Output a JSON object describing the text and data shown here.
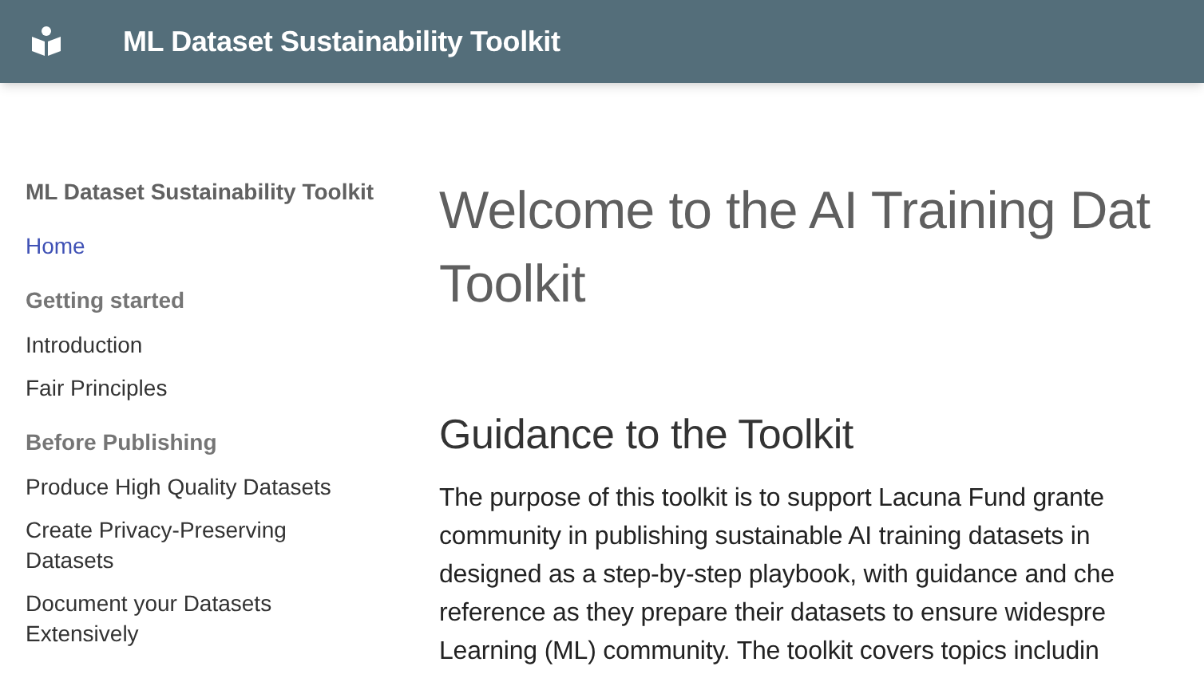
{
  "header": {
    "title": "ML Dataset Sustainability Toolkit"
  },
  "sidebar": {
    "title": "ML Dataset Sustainability Toolkit",
    "items": [
      {
        "kind": "link",
        "label": "Home",
        "selected": true
      },
      {
        "kind": "heading",
        "label": "Getting started"
      },
      {
        "kind": "link",
        "label": "Introduction",
        "selected": false
      },
      {
        "kind": "link",
        "label": "Fair Principles",
        "selected": false
      },
      {
        "kind": "heading",
        "label": "Before Publishing"
      },
      {
        "kind": "link",
        "label": "Produce High Quality Datasets",
        "selected": false
      },
      {
        "kind": "link",
        "label": "Create Privacy-Preserving Datasets",
        "selected": false
      },
      {
        "kind": "link",
        "label": "Document your Datasets Extensively",
        "selected": false
      }
    ]
  },
  "main": {
    "title_lines": [
      "Welcome to the AI Training Dat",
      "Toolkit"
    ],
    "section_heading": "Guidance to the Toolkit",
    "paragraph_lines": [
      "The purpose of this toolkit is to support Lacuna Fund grante",
      "community in publishing sustainable AI training datasets in",
      "designed as a step-by-step playbook, with guidance and che",
      "reference as they prepare their datasets to ensure widespre",
      "Learning (ML) community. The toolkit covers topics includin"
    ]
  }
}
